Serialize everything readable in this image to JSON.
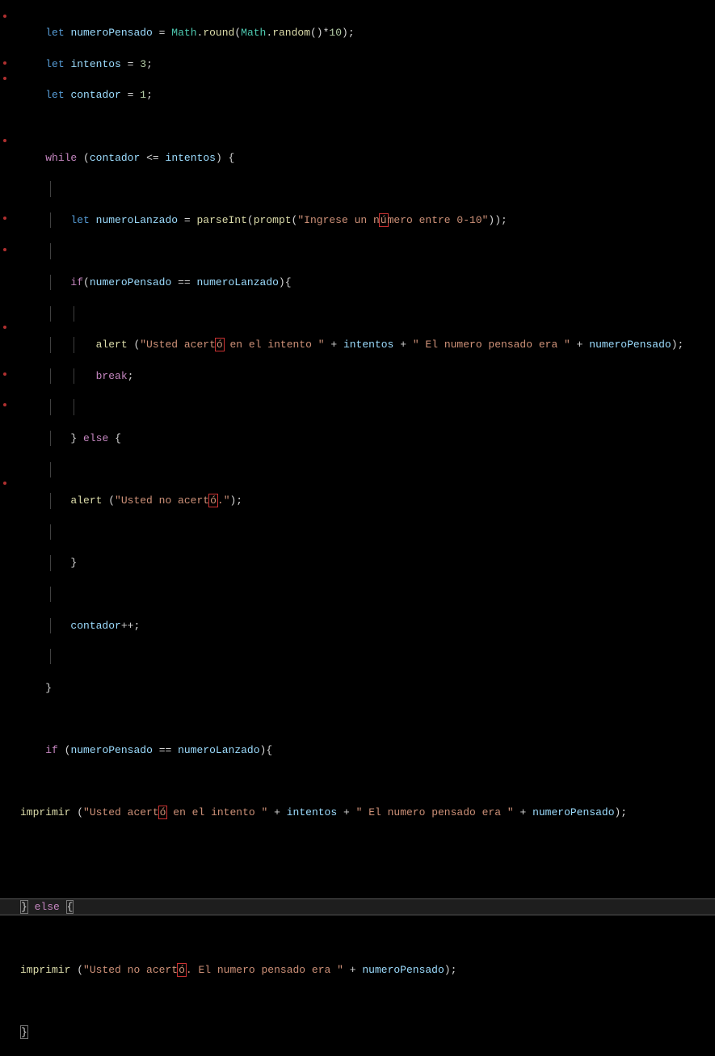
{
  "code": {
    "l1": {
      "let": "let",
      "v": "numeroPensado",
      "eq": "=",
      "cls": "Math",
      "dot1": ".",
      "fn1": "round",
      "op1": "(",
      "cls2": "Math",
      "dot2": ".",
      "fn2": "random",
      "op2": "()*",
      "n": "10",
      "end": ");"
    },
    "l2": {
      "let": "let",
      "v": "intentos",
      "eq": "=",
      "n": "3",
      "end": ";"
    },
    "l3": {
      "let": "let",
      "v": "contador",
      "eq": "=",
      "n": "1",
      "end": ";"
    },
    "l4": {
      "while": "while",
      "op1": "(",
      "v1": "contador",
      "op2": "<=",
      "v2": "intentos",
      "op3": ") {"
    },
    "l5": {
      "let": "let",
      "v": "numeroLanzado",
      "eq": "=",
      "fn1": "parseInt",
      "op1": "(",
      "fn2": "prompt",
      "op2": "(",
      "s1": "\"Ingrese un n",
      "serr": "ú",
      "s2": "mero entre 0-10\"",
      "end": "));"
    },
    "l6": {
      "if": "if",
      "op1": "(",
      "v1": "numeroPensado",
      "op2": "==",
      "v2": "numeroLanzado",
      "end": "){"
    },
    "l7": {
      "fn": "alert",
      "sp": " (",
      "s1": "\"Usted acert",
      "serr": "ó",
      "s2": " en el intento \"",
      "p1": "+",
      "v1": "intentos",
      "p2": "+",
      "s3": "\" El numero pensado era \"",
      "p3": "+",
      "v2": "numeroPensado",
      "end": ");"
    },
    "l8": {
      "break": "break",
      "end": ";"
    },
    "l9": {
      "close": "}",
      "else": "else",
      "open": "{"
    },
    "l10": {
      "fn": "alert",
      "sp": " (",
      "s1": "\"Usted no acert",
      "serr": "ó",
      "s2": ".\"",
      "end": ");"
    },
    "l11": {
      "close": "}"
    },
    "l12": {
      "v": "contador",
      "op": "++;"
    },
    "l13": {
      "close": "}"
    },
    "l14": {
      "if": "if",
      "op1": "(",
      "v1": "numeroPensado",
      "op2": "==",
      "v2": "numeroLanzado",
      "end": "){"
    },
    "l15": {
      "fn": "imprimir",
      "sp": " (",
      "s1": "\"Usted acert",
      "serr": "ó",
      "s2": " en el intento \"",
      "p1": "+",
      "v1": "intentos",
      "p2": "+",
      "s3": "\" El numero pensado era \"",
      "p3": "+",
      "v2": "numeroPensado",
      "end": ");"
    },
    "l16": {
      "close": "}",
      "else": "else",
      "open": "{"
    },
    "l17": {
      "fn": "imprimir",
      "sp": " (",
      "s1": "\"Usted no acert",
      "serr": "ó",
      "s2": ". El numero pensado era \"",
      "p1": "+",
      "v1": "numeroPensado",
      "end": ");"
    },
    "l18": {
      "close": "}"
    }
  }
}
